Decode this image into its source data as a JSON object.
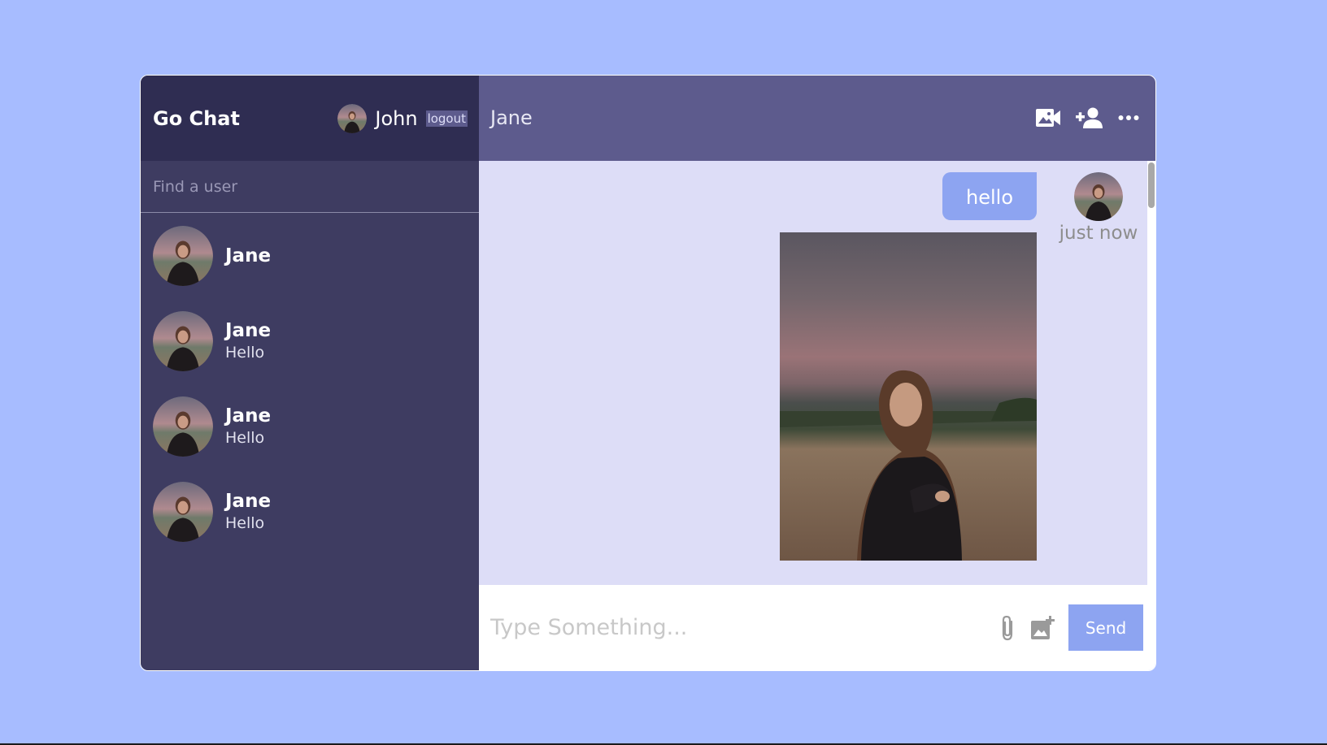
{
  "colors": {
    "page_background": "#a7bcff",
    "navbar": "#2f2d52",
    "sidebar": "#3e3c61",
    "chat_header": "#5d5b8d",
    "messages_background": "#ddddf7",
    "accent": "#8da4f1"
  },
  "navbar": {
    "logo": "Go Chat",
    "user_name": "John",
    "logout_label": "logout"
  },
  "search": {
    "placeholder": "Find a user"
  },
  "chats": [
    {
      "name": "Jane",
      "last_message": ""
    },
    {
      "name": "Jane",
      "last_message": "Hello"
    },
    {
      "name": "Jane",
      "last_message": "Hello"
    },
    {
      "name": "Jane",
      "last_message": "Hello"
    }
  ],
  "chat": {
    "title": "Jane",
    "icons": [
      "video-camera-icon",
      "add-user-icon",
      "more-options-icon"
    ],
    "messages": [
      {
        "text": "hello",
        "image": "photo",
        "time": "just now"
      }
    ]
  },
  "input": {
    "placeholder": "Type Something...",
    "attach_icon": "paperclip-icon",
    "image_icon": "add-image-icon",
    "send_label": "Send"
  }
}
